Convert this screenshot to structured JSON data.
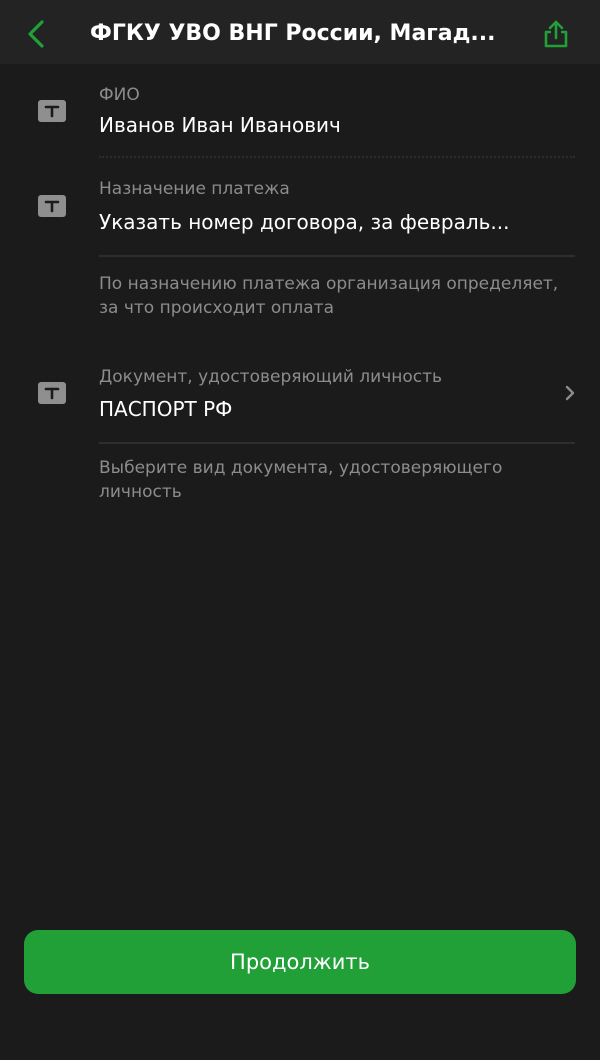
{
  "colors": {
    "accent": "#21a038",
    "background": "#1b1b1b",
    "topbar": "#232323",
    "label": "#8c8c8c",
    "icon_badge": "#8f8f8f"
  },
  "header": {
    "title": "ФГКУ УВО ВНГ России, Магад...",
    "back_icon": "chevron-left-icon",
    "share_icon": "share-icon"
  },
  "fields": [
    {
      "icon": "text-field-icon",
      "label": "ФИО",
      "value": "Иванов Иван Иванович"
    },
    {
      "icon": "text-field-icon",
      "label": "Назначение платежа",
      "value": "Указать номер договора, за февраль...",
      "hint": "По назначению платежа организация определяет, за что происходит оплата"
    },
    {
      "icon": "text-field-icon",
      "label": "Документ, удостоверяющий личность",
      "value": "ПАСПОРТ РФ",
      "hint": "Выберите вид документа, удостоверяющего личность",
      "chevron_icon": "chevron-right-icon"
    }
  ],
  "footer": {
    "continue_label": "Продолжить"
  }
}
